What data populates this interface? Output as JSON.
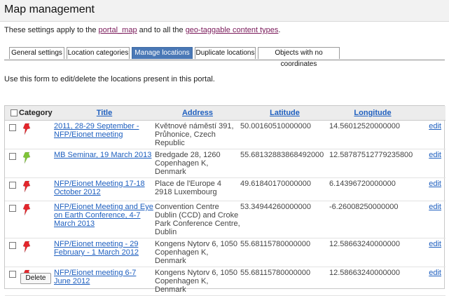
{
  "page_title": "Map management",
  "intro": {
    "before": "These settings apply to the ",
    "link1": "portal_map",
    "middle": " and to all the ",
    "link2": "geo-taggable content types",
    "after": "."
  },
  "tabs": [
    {
      "label": "General settings",
      "active": false
    },
    {
      "label": "Location categories",
      "active": false
    },
    {
      "label": "Manage locations",
      "active": true
    },
    {
      "label": "Duplicate locations",
      "active": false
    },
    {
      "label": "Objects with no coordinates",
      "active": false
    }
  ],
  "form_note": "Use this form to edit/delete the locations present in this portal.",
  "table": {
    "headers": {
      "category": "Category",
      "title": "Title",
      "address": "Address",
      "latitude": "Latitude",
      "longitude": "Longitude"
    },
    "edit_label": "edit",
    "rows": [
      {
        "pin_color": "red",
        "title": "2011, 28-29 September - NFP/Eionet meeting",
        "address": "Květnové náměstí 391, Průhonice, Czech Republic",
        "latitude": "50.00160510000000",
        "longitude": "14.56012520000000"
      },
      {
        "pin_color": "green",
        "title": "MB Seminar, 19 March 2013",
        "address": "Bredgade 28, 1260 Copenhagen K, Denmark",
        "latitude": "55.68132883868492000",
        "longitude": "12.58787512779235800"
      },
      {
        "pin_color": "red",
        "title": "NFP/Eionet Meeting 17-18 October 2012",
        "address": "Place de l'Europe 4 2918 Luxembourg",
        "latitude": "49.61840170000000",
        "longitude": "6.14396720000000"
      },
      {
        "pin_color": "red",
        "title": "NFP/Eionet Meeting and Eye on Earth Conference, 4-7 March 2013",
        "address": "Convention Centre Dublin (CCD) and Croke Park Conference Centre, Dublin",
        "latitude": "53.34944260000000",
        "longitude": "-6.26008250000000"
      },
      {
        "pin_color": "red",
        "title": "NFP/Eionet meeting - 29 February - 1 March 2012",
        "address": "Kongens Nytorv 6, 1050 Copenhagen K, Denmark",
        "latitude": "55.68115780000000",
        "longitude": "12.58663240000000"
      },
      {
        "pin_color": "red",
        "title": "NFP/Eionet meeting 6-7 June 2012",
        "address": "Kongens Nytorv 6, 1050 Copenhagen K, Denmark",
        "latitude": "55.68115780000000",
        "longitude": "12.58663240000000"
      }
    ]
  },
  "delete_button": "Delete",
  "colors": {
    "link": "#1e5fbf",
    "portal_link": "#7a1a5a",
    "active_tab": "#4a78b6",
    "pin_red": "#e3262c",
    "pin_green": "#7fc437"
  }
}
